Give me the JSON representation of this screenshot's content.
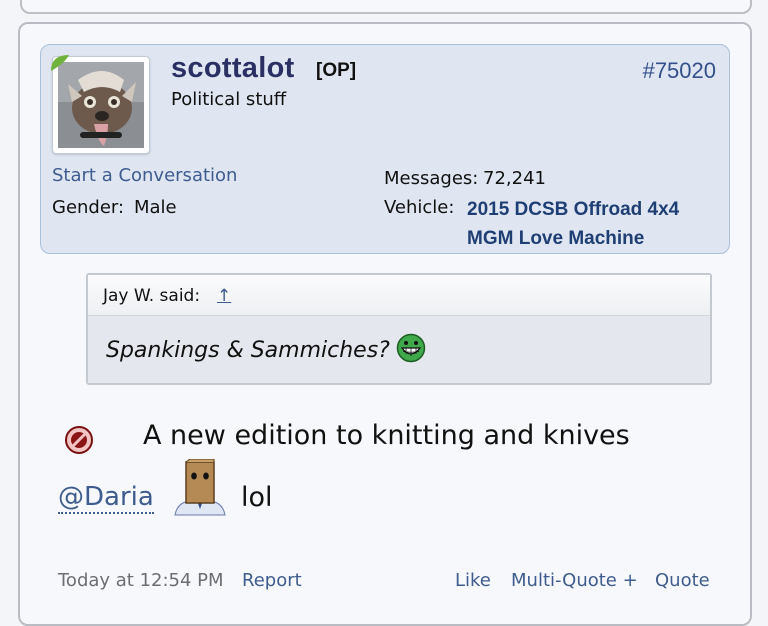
{
  "user": {
    "username": "scottalot",
    "op_tag": "[OP]",
    "title": "Political stuff",
    "post_number": "#75020",
    "start_conversation": "Start a Conversation",
    "gender_label": "Gender:",
    "gender_value": "Male",
    "messages_label": "Messages:",
    "messages_value": "72,241",
    "vehicle_label": "Vehicle:",
    "vehicle_value": "2015 DCSB Offroad 4x4 MGM Love Machine"
  },
  "quote": {
    "author": "Jay W. said:",
    "jump_arrow": "↑",
    "text": "Spankings & Sammiches?"
  },
  "post": {
    "line1": "A new edition to knitting and knives",
    "mention": "@Daria",
    "line2": "lol"
  },
  "footer": {
    "time": "Today at 12:54 PM",
    "report": "Report",
    "like": "Like",
    "multi_quote": "Multi-Quote +",
    "quote": "Quote"
  },
  "icons": {
    "online_indicator": "online-leaf-icon",
    "grin": "grin-smiley-icon",
    "post_icon": "no-entry-icon",
    "bag": "paper-bag-head-icon"
  },
  "colors": {
    "username": "#2b3063",
    "link": "#3f5c8e",
    "user_box_bg": "#dfe6f1",
    "online": "#6fb23c"
  }
}
